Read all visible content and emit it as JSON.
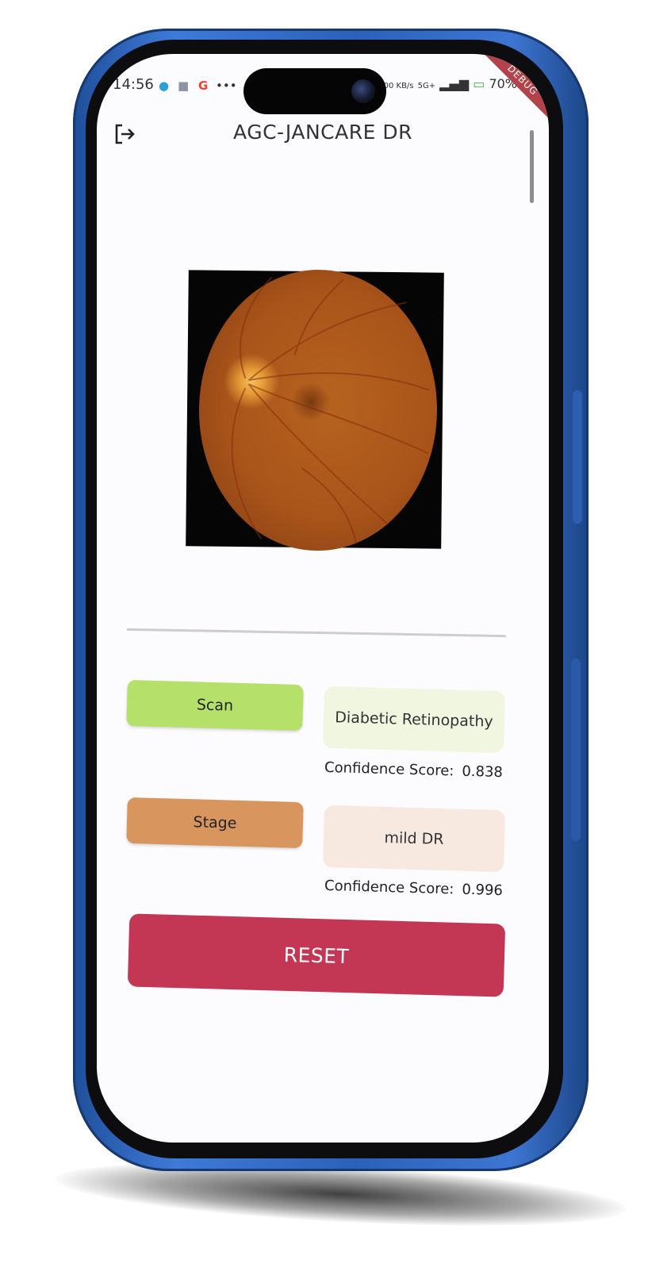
{
  "status_bar": {
    "time": "14:56",
    "network_speed": "0.00 KB/s",
    "network_type": "5G+",
    "battery": "70%"
  },
  "debug_banner": "DEBUG",
  "app_bar": {
    "title": "AGC-JANCARE DR",
    "logout_icon": "logout-icon"
  },
  "image": {
    "description_icon": "retina-fundus-image"
  },
  "buttons": {
    "scan": "Scan",
    "stage": "Stage",
    "reset": "RESET"
  },
  "results": {
    "diagnosis": "Diabetic Retinopathy",
    "diagnosis_confidence_label": "Confidence Score:",
    "diagnosis_confidence": "0.838",
    "stage": "mild DR",
    "stage_confidence_label": "Confidence Score:",
    "stage_confidence": "0.996"
  },
  "colors": {
    "scan_button": "#b5e06a",
    "stage_button": "#d8965e",
    "reset_button": "#c33654",
    "diagnosis_bg": "#f1f6e1",
    "stage_bg": "#f8e9e0",
    "phone_frame": "#2b61b8"
  }
}
